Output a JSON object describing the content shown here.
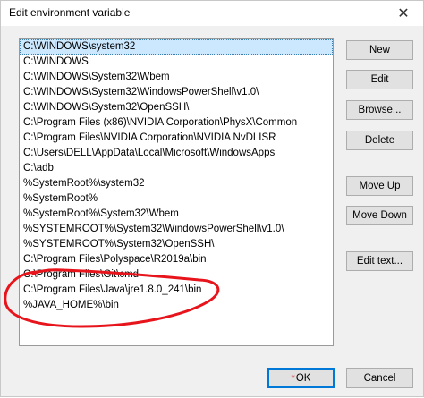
{
  "window": {
    "title": "Edit environment variable",
    "close_glyph": "✕"
  },
  "list": {
    "selected_index": 0,
    "items": [
      "C:\\WINDOWS\\system32",
      "C:\\WINDOWS",
      "C:\\WINDOWS\\System32\\Wbem",
      "C:\\WINDOWS\\System32\\WindowsPowerShell\\v1.0\\",
      "C:\\WINDOWS\\System32\\OpenSSH\\",
      "C:\\Program Files (x86)\\NVIDIA Corporation\\PhysX\\Common",
      "C:\\Program Files\\NVIDIA Corporation\\NVIDIA NvDLISR",
      "C:\\Users\\DELL\\AppData\\Local\\Microsoft\\WindowsApps",
      "C:\\adb",
      "%SystemRoot%\\system32",
      "%SystemRoot%",
      "%SystemRoot%\\System32\\Wbem",
      "%SYSTEMROOT%\\System32\\WindowsPowerShell\\v1.0\\",
      "%SYSTEMROOT%\\System32\\OpenSSH\\",
      "C:\\Program Files\\Polyspace\\R2019a\\bin",
      "C:\\Program Files\\Git\\cmd",
      "C:\\Program Files\\Java\\jre1.8.0_241\\bin",
      "%JAVA_HOME%\\bin"
    ]
  },
  "buttons": {
    "new": "New",
    "edit": "Edit",
    "browse": "Browse...",
    "delete": "Delete",
    "move_up": "Move Up",
    "move_down": "Move Down",
    "edit_text": "Edit text...",
    "ok": "OK",
    "ok_marker": "*",
    "cancel": "Cancel"
  },
  "colors": {
    "selection": "#cce8ff",
    "annotation_stroke": "#e8141c",
    "ok_border": "#0078d7"
  },
  "icons": {
    "close": "close-icon",
    "annotation": "red-freehand-circle"
  }
}
